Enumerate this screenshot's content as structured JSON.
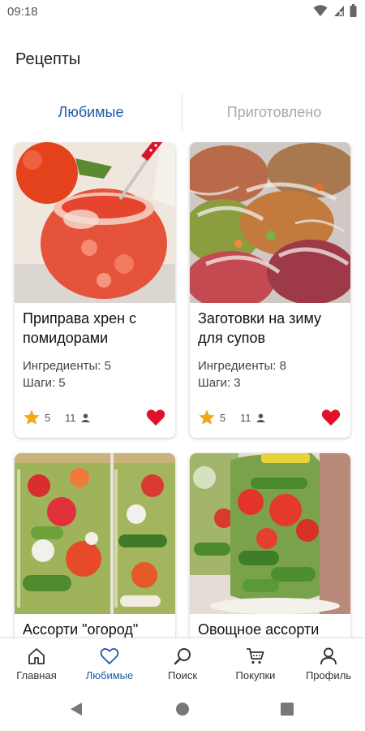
{
  "status_bar": {
    "time": "09:18"
  },
  "header": {
    "title": "Рецепты"
  },
  "tabs": [
    {
      "label": "Любимые",
      "active": true
    },
    {
      "label": "Приготовлено",
      "active": false
    }
  ],
  "recipes": [
    {
      "title": "Приправа хрен с помидорами",
      "ingredients": "Ингредиенты: 5",
      "steps": "Шаги: 5",
      "rating": "5",
      "users": "11",
      "favorite": true
    },
    {
      "title": "Заготовки на зиму для супов",
      "ingredients": "Ингредиенты: 8",
      "steps": "Шаги: 3",
      "rating": "5",
      "users": "11",
      "favorite": true
    },
    {
      "title": "Ассорти \"огород\"",
      "ingredients": "",
      "steps": "",
      "rating": "",
      "users": "",
      "favorite": true
    },
    {
      "title": "Овощное ассорти",
      "ingredients": "",
      "steps": "",
      "rating": "",
      "users": "",
      "favorite": true
    }
  ],
  "bottom_nav": [
    {
      "label": "Главная",
      "icon": "home-icon"
    },
    {
      "label": "Любимые",
      "icon": "heart-outline-icon",
      "active": true
    },
    {
      "label": "Поиск",
      "icon": "search-icon"
    },
    {
      "label": "Покупки",
      "icon": "cart-icon"
    },
    {
      "label": "Профиль",
      "icon": "profile-icon"
    }
  ],
  "colors": {
    "accent": "#1f5ca8",
    "heart": "#e0112b",
    "star": "#f2a81d",
    "inactive_tab": "#a9a9a9"
  }
}
